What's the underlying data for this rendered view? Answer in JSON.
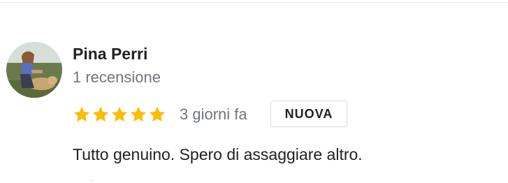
{
  "review": {
    "reviewer_name": "Pina Perri",
    "review_count": "1 recensione",
    "rating": 5,
    "rating_max": 5,
    "time_ago": "3 giorni fa",
    "badge": "NUOVA",
    "text": "Tutto genuino. Spero di assaggiare altro.",
    "avatar_icon": "profile-photo",
    "star_icon": "star-icon"
  },
  "colors": {
    "star": "#fbbc04",
    "name": "#202124",
    "secondary_text": "#70757a",
    "badge_border": "#dadce0",
    "divider": "#e8eaed"
  }
}
